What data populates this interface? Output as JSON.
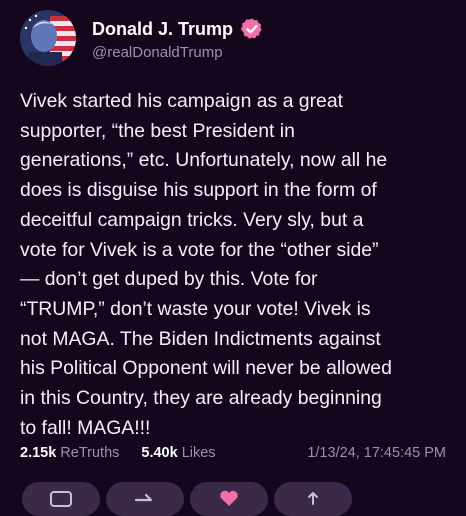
{
  "post": {
    "author": {
      "display_name": "Donald J. Trump",
      "handle": "@realDonaldTrump",
      "verified_icon": "verified-badge-icon",
      "verified_color": "#f36fa6"
    },
    "body": "Vivek started his campaign as a great\nsupporter, “the best President in\ngenerations,” etc. Unfortunately, now all he\ndoes is disguise his support in the form of\ndeceitful campaign tricks. Very sly, but a\nvote for Vivek is a vote for the “other side”\n— don’t get duped by this. Vote for\n“TRUMP,” don’t waste your vote! Vivek is\nnot MAGA. The Biden Indictments against\nhis Political Opponent will never be allowed\nin this Country, they are already beginning\nto fall! MAGA!!!",
    "stats": {
      "retruths_count": "2.15k",
      "retruths_label": "ReTruths",
      "likes_count": "5.40k",
      "likes_label": "Likes",
      "timestamp": "1/13/24, 17:45:45 PM"
    }
  },
  "actions": [
    {
      "icon": "reply-icon"
    },
    {
      "icon": "retruth-icon"
    },
    {
      "icon": "like-icon",
      "color": "#f36fa6"
    },
    {
      "icon": "share-icon"
    }
  ],
  "colors": {
    "background": "#14061d",
    "muted_text": "#9a92a8",
    "action_pill": "#3a2a47"
  }
}
